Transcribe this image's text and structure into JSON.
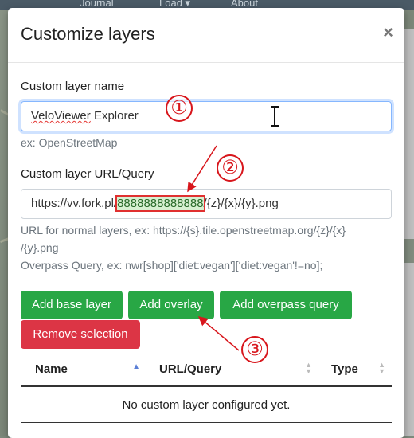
{
  "background": {
    "topbar_items": [
      "Journal",
      "Load ▾",
      "About"
    ]
  },
  "modal": {
    "title": "Customize layers",
    "close_label": "×",
    "name_label": "Custom layer name",
    "name_value_prefix": "VeloViewer",
    "name_value_suffix": " Explorer",
    "name_help": "ex: OpenStreetMap",
    "url_label": "Custom layer URL/Query",
    "url_value_prefix": "https://vv.fork.pl/",
    "url_value_highlight": "8888888888888",
    "url_value_suffix": "/{z}/{x}/{y}.png",
    "url_help_line1": "URL for normal layers, ex: https://{s}.tile.openstreetmap.org/{z}/{x}",
    "url_help_line2": "/{y}.png",
    "url_help_line3": "Overpass Query, ex: nwr[shop]['diet:vegan'][‘diet:vegan'!=no];",
    "buttons": {
      "add_base": "Add base layer",
      "add_overlay": "Add overlay",
      "add_overpass": "Add overpass query",
      "remove": "Remove selection"
    },
    "table": {
      "headers": [
        "Name",
        "URL/Query",
        "Type"
      ],
      "empty_text": "No custom layer configured yet."
    }
  },
  "annotations": [
    "①",
    "②",
    "③"
  ],
  "colors": {
    "primary_green": "#28a745",
    "danger_red": "#dc3545",
    "annotation_red": "#d8161c"
  }
}
